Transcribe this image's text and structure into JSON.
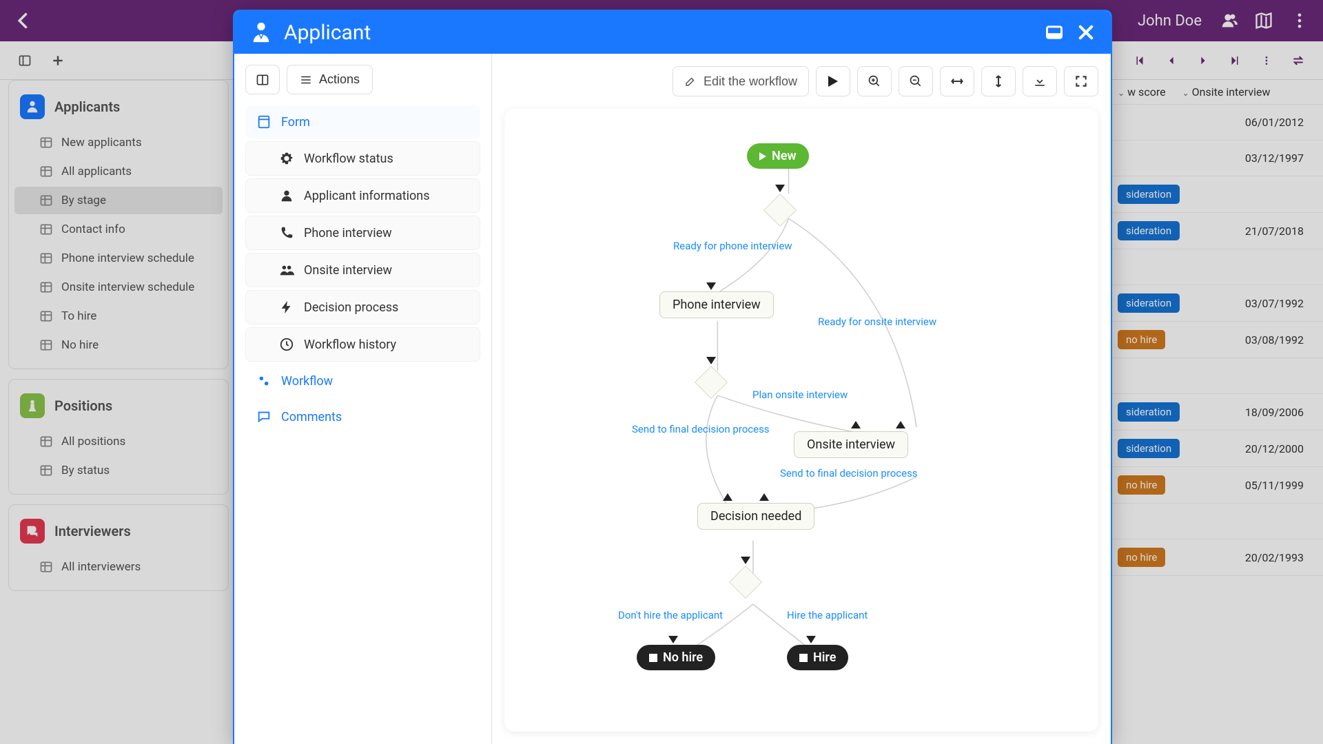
{
  "topbar": {
    "username": "John Doe"
  },
  "sidebar": {
    "groups": [
      {
        "title": "Applicants",
        "color": "#1a78ff",
        "items": [
          {
            "label": "New applicants"
          },
          {
            "label": "All applicants"
          },
          {
            "label": "By stage",
            "active": true
          },
          {
            "label": "Contact info"
          },
          {
            "label": "Phone interview schedule"
          },
          {
            "label": "Onsite interview schedule"
          },
          {
            "label": "To hire"
          },
          {
            "label": "No hire"
          }
        ]
      },
      {
        "title": "Positions",
        "color": "#8bc34a",
        "items": [
          {
            "label": "All positions"
          },
          {
            "label": "By status"
          }
        ]
      },
      {
        "title": "Interviewers",
        "color": "#e53950",
        "items": [
          {
            "label": "All interviewers"
          }
        ]
      }
    ]
  },
  "data_table": {
    "columns": [
      "w score",
      "Onsite interview"
    ],
    "rows": [
      {
        "badge": null,
        "date": "06/01/2012"
      },
      {
        "badge": null,
        "date": "03/12/1997"
      },
      {
        "badge": "sideration",
        "badge_color": "blue",
        "date": ""
      },
      {
        "badge": "sideration",
        "badge_color": "blue",
        "date": "21/07/2018"
      },
      {
        "badge": null,
        "date": ""
      },
      {
        "badge": "sideration",
        "badge_color": "blue",
        "date": "03/07/1992"
      },
      {
        "badge": "no hire",
        "badge_color": "orange",
        "date": "03/08/1992"
      },
      {
        "badge": null,
        "date": ""
      },
      {
        "badge": "sideration",
        "badge_color": "blue",
        "date": "18/09/2006"
      },
      {
        "badge": "sideration",
        "badge_color": "blue",
        "date": "20/12/2000"
      },
      {
        "badge": "no hire",
        "badge_color": "orange",
        "date": "05/11/1999"
      },
      {
        "badge": null,
        "date": ""
      },
      {
        "badge": "no hire",
        "badge_color": "orange",
        "date": "20/02/1993"
      }
    ]
  },
  "modal": {
    "title": "Applicant",
    "left": {
      "actions_label": "Actions",
      "nav": [
        {
          "label": "Form",
          "icon": "form",
          "type": "top"
        },
        {
          "label": "Workflow status",
          "icon": "gear",
          "type": "sub"
        },
        {
          "label": "Applicant informations",
          "icon": "user",
          "type": "sub"
        },
        {
          "label": "Phone interview",
          "icon": "phone",
          "type": "sub"
        },
        {
          "label": "Onsite interview",
          "icon": "people",
          "type": "sub"
        },
        {
          "label": "Decision process",
          "icon": "bolt",
          "type": "sub"
        },
        {
          "label": "Workflow history",
          "icon": "clock",
          "type": "sub"
        },
        {
          "label": "Workflow",
          "icon": "gears",
          "type": "plain"
        },
        {
          "label": "Comments",
          "icon": "comment",
          "type": "plain"
        }
      ]
    },
    "right": {
      "edit_label": "Edit the workflow"
    },
    "workflow": {
      "nodes": {
        "new": "New",
        "phone": "Phone interview",
        "onsite": "Onsite interview",
        "decision": "Decision needed",
        "nohire": "No hire",
        "hire": "Hire"
      },
      "edges": {
        "ready_phone": "Ready for phone interview",
        "ready_onsite": "Ready for onsite interview",
        "plan_onsite": "Plan onsite interview",
        "send_final_1": "Send to final decision process",
        "send_final_2": "Send to final decision process",
        "dont_hire": "Don't hire the applicant",
        "hire": "Hire the applicant"
      }
    }
  }
}
